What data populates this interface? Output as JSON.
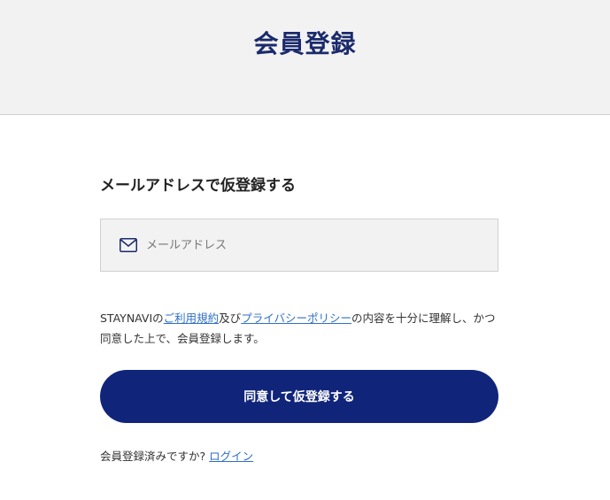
{
  "header": {
    "title": "会員登録"
  },
  "form": {
    "heading": "メールアドレスで仮登録する",
    "email_placeholder": "メールアドレス",
    "email_value": "",
    "email_icon": "mail-icon"
  },
  "terms": {
    "prefix": "STAYNAVIの",
    "terms_link": "ご利用規約",
    "conjunction": "及び",
    "privacy_link": "プライバシーポリシー",
    "suffix": "の内容を十分に理解し、かつ同意した上で、会員登録します。"
  },
  "submit": {
    "label": "同意して仮登録する"
  },
  "login": {
    "prompt": "会員登録済みですか?",
    "link": "ログイン"
  },
  "colors": {
    "brand_navy": "#10257a",
    "title_navy": "#1a2a6c",
    "link_blue": "#2f6fc4",
    "header_bg": "#f2f2f2"
  }
}
